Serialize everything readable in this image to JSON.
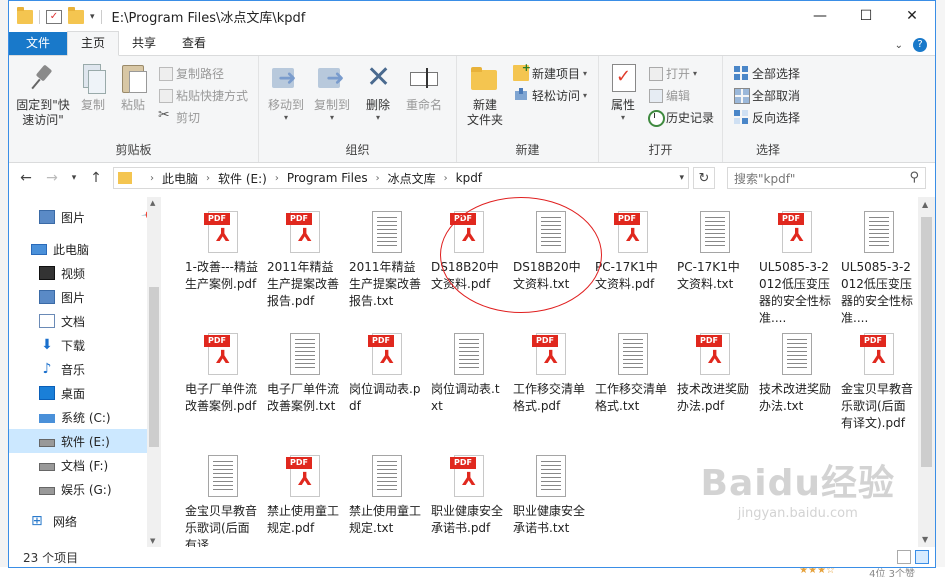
{
  "window": {
    "title": "E:\\Program Files\\冰点文库\\kpdf",
    "minimize": "—",
    "maximize": "☐",
    "close": "✕"
  },
  "ribbon_tabs": [
    "文件",
    "主页",
    "共享",
    "查看"
  ],
  "ribbon": {
    "clipboard": {
      "group": "剪贴板",
      "pin": "固定到\"快\n速访问\"",
      "copy": "复制",
      "paste": "粘贴",
      "copy_path": "复制路径",
      "paste_shortcut": "粘贴快捷方式",
      "cut": "剪切"
    },
    "organize": {
      "group": "组织",
      "move_to": "移动到",
      "copy_to": "复制到",
      "delete": "删除",
      "rename": "重命名"
    },
    "new": {
      "group": "新建",
      "new_folder": "新建\n文件夹",
      "new_item": "新建项目",
      "easy_access": "轻松访问"
    },
    "open": {
      "group": "打开",
      "properties": "属性",
      "open": "打开",
      "edit": "编辑",
      "history": "历史记录"
    },
    "select": {
      "group": "选择",
      "select_all": "全部选择",
      "select_none": "全部取消",
      "invert": "反向选择"
    }
  },
  "address": {
    "crumbs": [
      "此电脑",
      "软件 (E:)",
      "Program Files",
      "冰点文库",
      "kpdf"
    ],
    "search_placeholder": "搜索\"kpdf\""
  },
  "nav": [
    {
      "label": "图片",
      "icon": "picture-icon",
      "pinned": true
    },
    {
      "label": "此电脑",
      "icon": "computer-icon"
    },
    {
      "label": "视频",
      "icon": "video-icon"
    },
    {
      "label": "图片",
      "icon": "picture-icon"
    },
    {
      "label": "文档",
      "icon": "document-icon"
    },
    {
      "label": "下载",
      "icon": "download-icon"
    },
    {
      "label": "音乐",
      "icon": "music-icon"
    },
    {
      "label": "桌面",
      "icon": "desktop-icon"
    },
    {
      "label": "系统 (C:)",
      "icon": "system-drive-icon"
    },
    {
      "label": "软件 (E:)",
      "icon": "drive-icon",
      "selected": true
    },
    {
      "label": "文档 (F:)",
      "icon": "drive-icon"
    },
    {
      "label": "娱乐 (G:)",
      "icon": "drive-icon"
    },
    {
      "label": "网络",
      "icon": "network-icon"
    }
  ],
  "files": [
    {
      "name": "1-改善---精益生产案例.pdf",
      "type": "pdf"
    },
    {
      "name": "2011年精益生产提案改善报告.pdf",
      "type": "pdf"
    },
    {
      "name": "2011年精益生产提案改善报告.txt",
      "type": "txt"
    },
    {
      "name": "DS18B20中文资料.pdf",
      "type": "pdf"
    },
    {
      "name": "DS18B20中文资料.txt",
      "type": "txt"
    },
    {
      "name": "PC-17K1中文资料.pdf",
      "type": "pdf"
    },
    {
      "name": "PC-17K1中文资料.txt",
      "type": "txt"
    },
    {
      "name": "UL5085-3-2012低压变压器的安全性标准....",
      "type": "pdf"
    },
    {
      "name": "UL5085-3-2012低压变压器的安全性标准....",
      "type": "txt"
    },
    {
      "name": "电子厂单件流改善案例.pdf",
      "type": "pdf"
    },
    {
      "name": "电子厂单件流改善案例.txt",
      "type": "txt"
    },
    {
      "name": "岗位调动表.pdf",
      "type": "pdf"
    },
    {
      "name": "岗位调动表.txt",
      "type": "txt"
    },
    {
      "name": "工作移交清单格式.pdf",
      "type": "pdf"
    },
    {
      "name": "工作移交清单格式.txt",
      "type": "txt"
    },
    {
      "name": "技术改进奖励办法.pdf",
      "type": "pdf"
    },
    {
      "name": "技术改进奖励办法.txt",
      "type": "txt"
    },
    {
      "name": "金宝贝早教音乐歌词(后面有译文).pdf",
      "type": "pdf"
    },
    {
      "name": "金宝贝早教音乐歌词(后面有译",
      "type": "txt"
    },
    {
      "name": "禁止使用童工规定.pdf",
      "type": "pdf"
    },
    {
      "name": "禁止使用童工规定.txt",
      "type": "txt"
    },
    {
      "name": "职业健康安全承诺书.pdf",
      "type": "pdf"
    },
    {
      "name": "职业健康安全承诺书.txt",
      "type": "txt"
    }
  ],
  "pdf_tag": "PDF",
  "status": "23 个项目",
  "watermark": {
    "brand": "Baidu经验",
    "url": "jingyan.baidu.com"
  },
  "background": {
    "meta": "4位 3个赞"
  },
  "colors": {
    "accent": "#1979ca",
    "pdf_red": "#e0281e",
    "selection": "#cce8ff",
    "annotation_circle": "#e02020"
  }
}
